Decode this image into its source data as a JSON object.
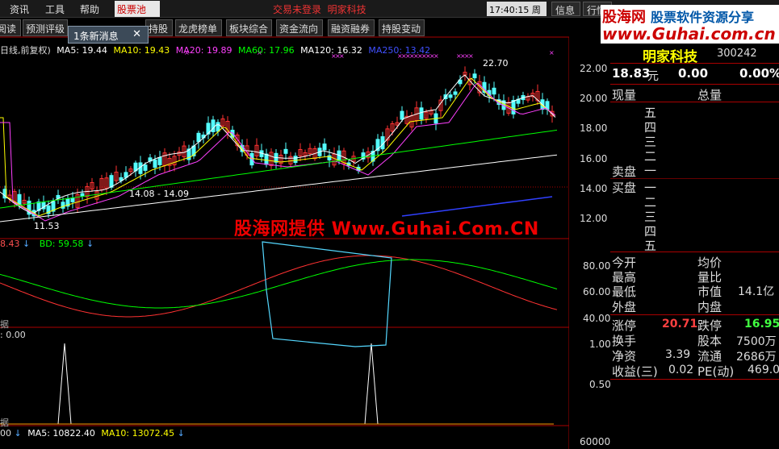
{
  "menubar": {
    "items": [
      "资讯",
      "工具",
      "帮助"
    ],
    "stock_pool": "股票池",
    "status": "交易未登录",
    "stock_name": "明家科技",
    "time": "17:40:15 周三",
    "info_button": "信息",
    "market_button": "行情"
  },
  "toolbar": {
    "buttons": [
      "阅读",
      "预测评级",
      "持股",
      "龙虎榜单",
      "板块综合",
      "资金流向",
      "融资融券",
      "持股变动"
    ]
  },
  "notification": {
    "text": "1条新消息",
    "close": "✕"
  },
  "legend": {
    "title": "日线,前复权)",
    "ma5": "MA5: 19.44",
    "ma10": "MA10: 19.43",
    "ma20": "MA20: 19.89",
    "ma60": "MA60: 17.96",
    "ma120": "MA120: 16.32",
    "ma250": "MA250: 13.42"
  },
  "price_axis": [
    "22.00",
    "20.00",
    "18.00",
    "16.00",
    "14.00",
    "12.00"
  ],
  "annotations": {
    "high": "22.70",
    "mid": "14.08 - 14.09",
    "low": "11.53"
  },
  "indicator": {
    "label_a": "8.43",
    "label_b": "BD: 59.58",
    "ticks": [
      "80.00",
      "60.00",
      "40.00"
    ]
  },
  "signal": {
    "label_a": "据",
    "value": ": 0.00",
    "ticks": [
      "1.00",
      "0.50"
    ]
  },
  "volume": {
    "left": "00",
    "ma5": "MA5: 10822.40",
    "ma10": "MA10: 13072.45",
    "left_label": "据",
    "tick": "60000"
  },
  "watermark": "股海网提供 Www.Guhai.Com.CN",
  "logo": {
    "main": "股海网",
    "slogan": "股票软件资源分享",
    "url": "www.Guhai.com.cn"
  },
  "quote": {
    "name": "明家科技",
    "code": "300242",
    "price": "18.83",
    "price_unit": "元",
    "change": "0.00",
    "change_pct": "0.00%",
    "current_vol": "现量",
    "total_vol": "总量",
    "sell_levels": [
      "五",
      "四",
      "三",
      "二",
      "一"
    ],
    "buy_levels": [
      "一",
      "二",
      "三",
      "四",
      "五"
    ],
    "sell_label": "卖盘",
    "buy_label": "买盘"
  },
  "stats": {
    "open": "今开",
    "avg": "均价",
    "high": "最高",
    "vol_ratio": "量比",
    "low": "最低",
    "mkt_cap": "市值",
    "mkt_cap_val": "14.1亿",
    "outer": "外盘",
    "inner": "内盘"
  },
  "limits": {
    "up_label": "涨停",
    "up_val": "20.71",
    "down_label": "跌停",
    "down_val": "16.95",
    "turnover": "换手",
    "shares": "股本",
    "shares_val": "7500万",
    "net_assets": "净资",
    "net_assets_val": "3.39",
    "float": "流通",
    "float_val": "2686万",
    "eps": "收益(三)",
    "eps_val": "0.02",
    "pe": "PE(动)",
    "pe_val": "469.0"
  },
  "colors": {
    "up": "#ff3232",
    "down": "#54ffff",
    "ma5": "#ffffff",
    "ma10": "#ffff00",
    "ma20": "#ff40ff",
    "ma60": "#00ff00",
    "ma120": "#ffffff",
    "ma250": "#3040ff"
  }
}
